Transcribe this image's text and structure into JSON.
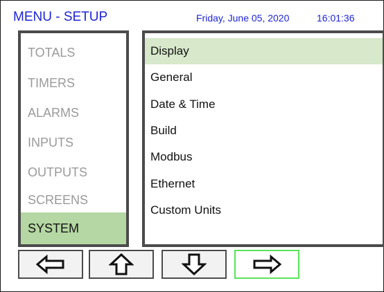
{
  "header": {
    "title": "MENU - SETUP",
    "date": "Friday, June 05, 2020",
    "time": "16:01:36"
  },
  "colors": {
    "header_text": "#1e24d6",
    "active_category": "#b5d7a3",
    "active_item": "#d7e8cb",
    "selected_button_border": "#59e35a",
    "inactive_text": "#9a9a9a"
  },
  "categories": {
    "items": [
      {
        "label": "TOTALS",
        "active": false
      },
      {
        "label": "TIMERS",
        "active": false
      },
      {
        "label": "ALARMS",
        "active": false
      },
      {
        "label": "INPUTS",
        "active": false
      },
      {
        "label": "OUTPUTS",
        "active": false
      },
      {
        "label": "SCREENS",
        "active": false
      },
      {
        "label": "SYSTEM",
        "active": true
      }
    ]
  },
  "submenu": {
    "items": [
      {
        "label": "Display",
        "active": true
      },
      {
        "label": "General",
        "active": false
      },
      {
        "label": "Date & Time",
        "active": false
      },
      {
        "label": "Build",
        "active": false
      },
      {
        "label": "Modbus",
        "active": false
      },
      {
        "label": "Ethernet",
        "active": false
      },
      {
        "label": "Custom Units",
        "active": false
      }
    ]
  },
  "nav": {
    "buttons": [
      {
        "icon": "arrow-left-icon",
        "selected": false
      },
      {
        "icon": "arrow-up-icon",
        "selected": false
      },
      {
        "icon": "arrow-down-icon",
        "selected": false
      },
      {
        "icon": "arrow-right-icon",
        "selected": true
      }
    ]
  }
}
